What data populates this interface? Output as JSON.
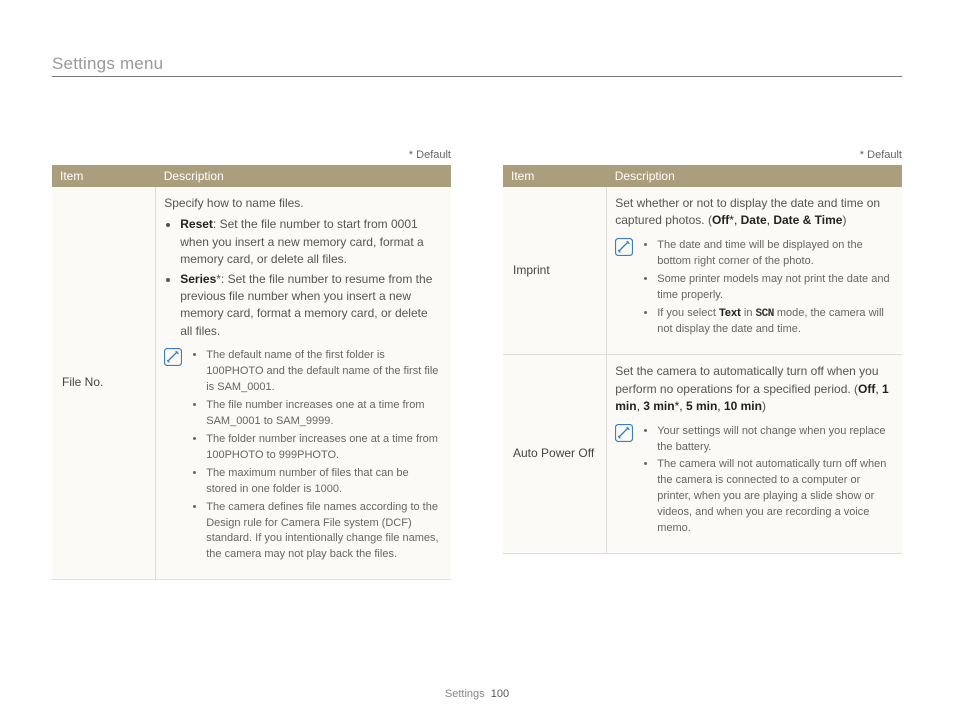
{
  "page_title": "Settings menu",
  "default_note": "* Default",
  "header_item": "Item",
  "header_desc": "Description",
  "footer_section": "Settings",
  "footer_page": "100",
  "left": {
    "row": {
      "item": "File No.",
      "intro": "Specify how to name files.",
      "bullets": [
        {
          "label": "Reset",
          "text": ": Set the file number to start from 0001 when you insert a new memory card, format a memory card, or delete all files."
        },
        {
          "label": "Series",
          "suffix": "*",
          "text": ": Set the file number to resume from the previous file number when you insert a new memory card, format a memory card, or delete all files."
        }
      ],
      "notes": [
        "The default name of the first folder is 100PHOTO and the default name of the first file is SAM_0001.",
        "The file number increases one at a time from SAM_0001 to SAM_9999.",
        "The folder number increases one at a time from 100PHOTO to 999PHOTO.",
        "The maximum number of files that can be stored in one folder is 1000.",
        "The camera defines file names according to the Design rule for Camera File system (DCF) standard. If you intentionally change file names, the camera may not play back the files."
      ]
    }
  },
  "right": {
    "rows": [
      {
        "item": "Imprint",
        "intro": "Set whether or not to display the date and time on captured photos. (",
        "options_html": "Off*, Date, Date & Time",
        "opt_off": "Off",
        "opt_off_sfx": "*",
        "opt_date": "Date",
        "opt_dt": "Date & Time",
        "close": ")",
        "notes": [
          "The date and time will be displayed on the bottom right corner of the photo.",
          "Some printer models may not print the date and time properly.",
          "If you select Text in SCN mode, the camera will not display the date and time."
        ],
        "note_text_label": "Text",
        "note_scn": "SCN"
      },
      {
        "item": "Auto Power Off",
        "intro": "Set the camera to automatically turn off when you perform no operations for a specified period. (",
        "opt1": "Off",
        "opt2": "1 min",
        "opt3": "3 min",
        "opt3_sfx": "*",
        "opt4": "5 min",
        "opt5": "10 min",
        "close": ")",
        "notes": [
          "Your settings will not change when you replace the battery.",
          "The camera will not automatically turn off when the camera is connected to a computer or printer, when you are playing a slide show or videos, and when you are recording a voice memo."
        ]
      }
    ]
  }
}
